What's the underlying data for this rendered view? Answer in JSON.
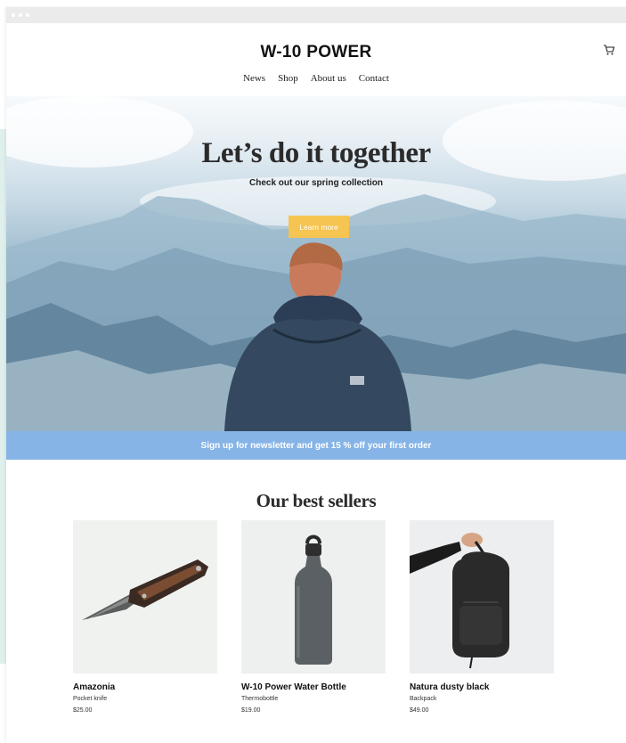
{
  "brand": {
    "name": "W-10 POWER"
  },
  "nav": {
    "items": [
      "News",
      "Shop",
      "About us",
      "Contact"
    ]
  },
  "hero": {
    "title": "Let’s do it together",
    "subtitle": "Check out our spring collection",
    "button_label": "Learn more",
    "button_color": "#f5c451"
  },
  "newsletter": {
    "text": "Sign up for newsletter and get 15 % off your first order",
    "color": "#86b4e6"
  },
  "best_sellers": {
    "title": "Our best sellers",
    "products": [
      {
        "name": "Amazonia",
        "type": "Pocket knife",
        "price": "$25.00"
      },
      {
        "name": "W-10 Power Water Bottle",
        "type": "Thermobottle",
        "price": "$19.00"
      },
      {
        "name": "Natura dusty black",
        "type": "Backpack",
        "price": "$49.00"
      }
    ]
  },
  "icons": [
    "cart-icon"
  ]
}
